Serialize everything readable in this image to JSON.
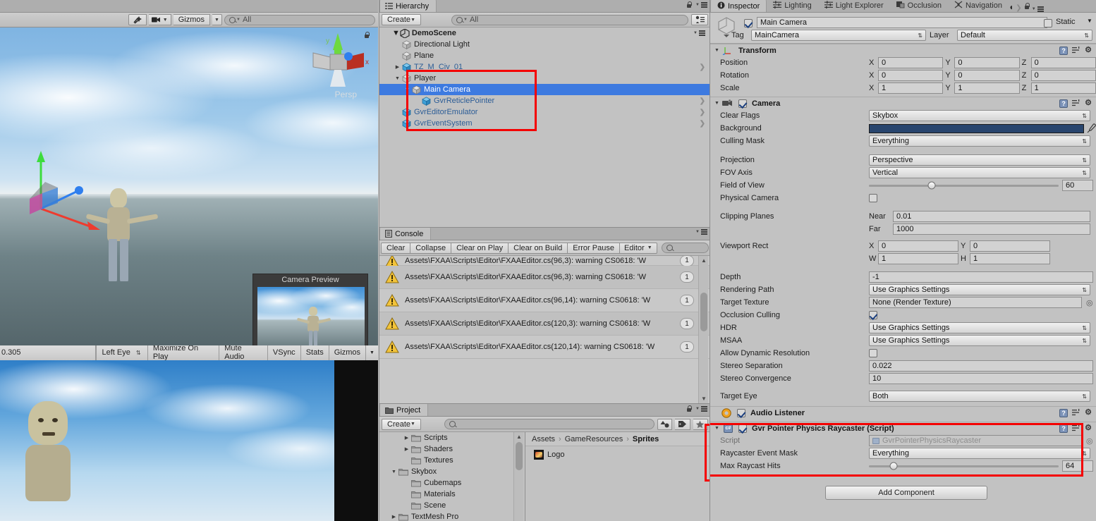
{
  "scene_view": {
    "tools": {
      "gizmo_toggle": "effects-icon",
      "camera_icon": "camera-icon",
      "gizmos_label": "Gizmos"
    },
    "search_placeholder": "All",
    "persp_label": "Persp"
  },
  "camera_preview": {
    "title": "Camera Preview"
  },
  "game_view": {
    "aspect_partial": "0.305",
    "eye": "Left Eye",
    "maximize": "Maximize On Play",
    "mute": "Mute Audio",
    "vsync": "VSync",
    "stats": "Stats",
    "gizmos": "Gizmos"
  },
  "hierarchy": {
    "tab": "Hierarchy",
    "create_label": "Create",
    "search_placeholder": "All",
    "scene_name": "DemoScene",
    "items": [
      {
        "label": "Directional Light",
        "depth": 1,
        "twisty": "",
        "prefab": false,
        "selected": false,
        "chevron": false
      },
      {
        "label": "Plane",
        "depth": 1,
        "twisty": "",
        "prefab": false,
        "selected": false,
        "chevron": false
      },
      {
        "label": "TZ_M_Civ_01",
        "depth": 1,
        "twisty": "▶",
        "prefab": true,
        "selected": false,
        "chevron": true
      },
      {
        "label": "Player",
        "depth": 1,
        "twisty": "▼",
        "prefab": false,
        "selected": false,
        "chevron": false
      },
      {
        "label": "Main Camera",
        "depth": 2,
        "twisty": "▼",
        "prefab": false,
        "selected": true,
        "chevron": false
      },
      {
        "label": "GvrReticlePointer",
        "depth": 3,
        "twisty": "",
        "prefab": true,
        "selected": false,
        "chevron": true
      },
      {
        "label": "GvrEditorEmulator",
        "depth": 1,
        "twisty": "",
        "prefab": true,
        "selected": false,
        "chevron": true
      },
      {
        "label": "GvrEventSystem",
        "depth": 1,
        "twisty": "",
        "prefab": true,
        "selected": false,
        "chevron": true
      }
    ]
  },
  "console": {
    "tab": "Console",
    "buttons": [
      "Clear",
      "Collapse",
      "Clear on Play",
      "Clear on Build",
      "Error Pause"
    ],
    "editor_label": "Editor",
    "rows": [
      {
        "message": "Assets\\FXAA\\Scripts\\Editor\\FXAAEditor.cs(96,3): warning CS0618: 'W",
        "count": "1",
        "partial": true
      },
      {
        "message": "Assets\\FXAA\\Scripts\\Editor\\FXAAEditor.cs(96,3): warning CS0618: 'W",
        "count": "1",
        "partial": false
      },
      {
        "message": "Assets\\FXAA\\Scripts\\Editor\\FXAAEditor.cs(96,14): warning CS0618: 'W",
        "count": "1",
        "partial": false
      },
      {
        "message": "Assets\\FXAA\\Scripts\\Editor\\FXAAEditor.cs(120,3): warning CS0618: 'W",
        "count": "1",
        "partial": false
      },
      {
        "message": "Assets\\FXAA\\Scripts\\Editor\\FXAAEditor.cs(120,14): warning CS0618: 'W",
        "count": "1",
        "partial": false
      }
    ]
  },
  "project": {
    "tab": "Project",
    "create_label": "Create",
    "folders": [
      {
        "label": "Scripts",
        "depth": 1,
        "twisty": "▶"
      },
      {
        "label": "Shaders",
        "depth": 1,
        "twisty": "▶"
      },
      {
        "label": "Textures",
        "depth": 1,
        "twisty": ""
      },
      {
        "label": "Skybox",
        "depth": 0,
        "twisty": "▼"
      },
      {
        "label": "Cubemaps",
        "depth": 1,
        "twisty": ""
      },
      {
        "label": "Materials",
        "depth": 1,
        "twisty": ""
      },
      {
        "label": "Scene",
        "depth": 1,
        "twisty": ""
      },
      {
        "label": "TextMesh Pro",
        "depth": 0,
        "twisty": "▶"
      }
    ],
    "breadcrumb": [
      "Assets",
      "GameResources",
      "Sprites"
    ],
    "assets": [
      {
        "label": "Logo"
      }
    ]
  },
  "inspector": {
    "tabs": [
      {
        "label": "Inspector",
        "icon": "info-icon",
        "active": true
      },
      {
        "label": "Lighting",
        "icon": "sliders-icon",
        "active": false
      },
      {
        "label": "Light Explorer",
        "icon": "sliders-icon",
        "active": false
      },
      {
        "label": "Occlusion",
        "icon": "occlusion-icon",
        "active": false
      },
      {
        "label": "Navigation",
        "icon": "navigation-icon",
        "active": false
      }
    ],
    "object_name": "Main Camera",
    "static_label": "Static",
    "tag_label": "Tag",
    "tag_value": "MainCamera",
    "layer_label": "Layer",
    "layer_value": "Default",
    "transform": {
      "title": "Transform",
      "rows": [
        {
          "label": "Position",
          "x": "0",
          "y": "0",
          "z": "0"
        },
        {
          "label": "Rotation",
          "x": "0",
          "y": "0",
          "z": "0"
        },
        {
          "label": "Scale",
          "x": "1",
          "y": "1",
          "z": "1"
        }
      ]
    },
    "camera": {
      "title": "Camera",
      "clear_flags_label": "Clear Flags",
      "clear_flags_value": "Skybox",
      "background_label": "Background",
      "background_color": "#28456e",
      "culling_mask_label": "Culling Mask",
      "culling_mask_value": "Everything",
      "projection_label": "Projection",
      "projection_value": "Perspective",
      "fov_axis_label": "FOV Axis",
      "fov_axis_value": "Vertical",
      "field_of_view_label": "Field of View",
      "field_of_view_value": "60",
      "physical_camera_label": "Physical Camera",
      "clipping_planes_label": "Clipping Planes",
      "near_label": "Near",
      "near_value": "0.01",
      "far_label": "Far",
      "far_value": "1000",
      "viewport_rect_label": "Viewport Rect",
      "viewport_x": "0",
      "viewport_y": "0",
      "viewport_w": "1",
      "viewport_h": "1",
      "depth_label": "Depth",
      "depth_value": "-1",
      "rendering_path_label": "Rendering Path",
      "rendering_path_value": "Use Graphics Settings",
      "target_texture_label": "Target Texture",
      "target_texture_value": "None (Render Texture)",
      "occlusion_culling_label": "Occlusion Culling",
      "hdr_label": "HDR",
      "hdr_value": "Use Graphics Settings",
      "msaa_label": "MSAA",
      "msaa_value": "Use Graphics Settings",
      "allow_dynamic_resolution_label": "Allow Dynamic Resolution",
      "stereo_separation_label": "Stereo Separation",
      "stereo_separation_value": "0.022",
      "stereo_convergence_label": "Stereo Convergence",
      "stereo_convergence_value": "10",
      "target_eye_label": "Target Eye",
      "target_eye_value": "Both"
    },
    "audio_listener": {
      "title": "Audio Listener"
    },
    "raycaster": {
      "title": "Gvr Pointer Physics Raycaster (Script)",
      "script_label": "Script",
      "script_value": "GvrPointerPhysicsRaycaster",
      "event_mask_label": "Raycaster Event Mask",
      "event_mask_value": "Everything",
      "max_hits_label": "Max Raycast Hits",
      "max_hits_value": "64"
    },
    "add_component_label": "Add Component"
  },
  "colors": {
    "selection_blue": "#3d7ae0",
    "highlight_red": "#f40000",
    "prefab_text": "#2b5c96",
    "panel_bg": "#c2c2c2"
  }
}
